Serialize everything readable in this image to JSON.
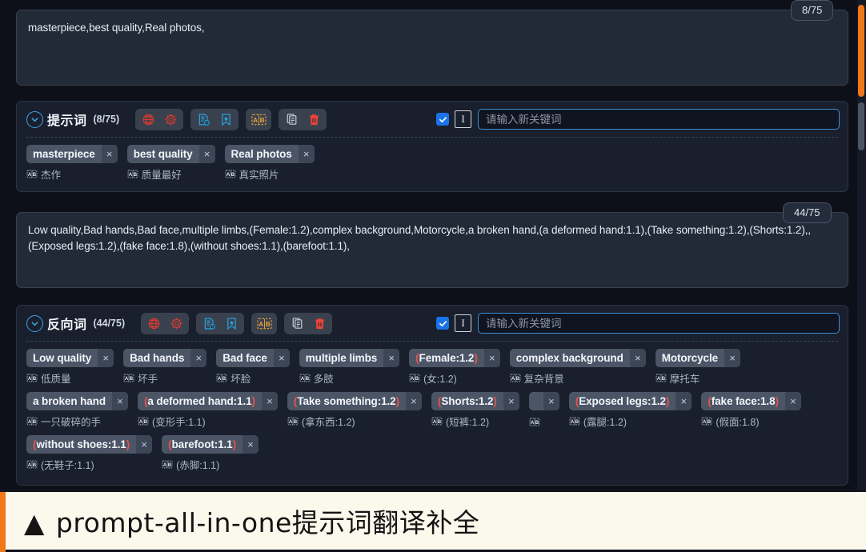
{
  "theme": {
    "bg": "#0d1019",
    "panel": "#191f2c",
    "textarea_bg": "#222a38",
    "accent_blue": "#3aa6e8",
    "accent_orange": "#f07818",
    "chip_bg": "#4b5566",
    "weight_paren": "#e8544a"
  },
  "positive": {
    "textarea_value": "masterpiece,best quality,Real photos,",
    "counter": "8/75",
    "section": {
      "title": "提示词",
      "count": "(8/75)",
      "collapse_icon": "chevron-down-circle-icon",
      "icon_groups": [
        {
          "name": "network-group",
          "icons": [
            {
              "name": "globe-icon",
              "color": "#d93a2f"
            },
            {
              "name": "gear-icon",
              "color": "#d93a2f"
            }
          ]
        },
        {
          "name": "history-group",
          "icons": [
            {
              "name": "document-history-icon",
              "color": "#29a3e0"
            },
            {
              "name": "bookmark-star-icon",
              "color": "#29a3e0"
            }
          ]
        },
        {
          "name": "translate-group",
          "icons": [
            {
              "name": "ab-translate-icon",
              "color": "#e8a33d"
            }
          ]
        },
        {
          "name": "edit-group",
          "icons": [
            {
              "name": "copy-icon",
              "color": "#c8d0dc"
            },
            {
              "name": "trash-icon",
              "color": "#e8443a"
            }
          ]
        }
      ],
      "checkbox_checked": true,
      "cursor_icon": "text-cursor-icon",
      "input_placeholder": "请输入新关键词",
      "input_value": ""
    },
    "tags": [
      {
        "label": "masterpiece",
        "translation": "杰作"
      },
      {
        "label": "best quality",
        "translation": "质量最好"
      },
      {
        "label": "Real photos",
        "translation": "真实照片"
      }
    ]
  },
  "negative": {
    "textarea_value": "Low quality,Bad hands,Bad face,multiple limbs,(Female:1.2),complex background,Motorcycle,a broken hand,(a deformed hand:1.1),(Take something:1.2),(Shorts:1.2),,(Exposed legs:1.2),(fake face:1.8),(without shoes:1.1),(barefoot:1.1),",
    "counter": "44/75",
    "section": {
      "title": "反向词",
      "count": "(44/75)",
      "collapse_icon": "chevron-down-circle-icon",
      "icon_groups": [
        {
          "name": "network-group",
          "icons": [
            {
              "name": "globe-icon",
              "color": "#d93a2f"
            },
            {
              "name": "gear-icon",
              "color": "#d93a2f"
            }
          ]
        },
        {
          "name": "history-group",
          "icons": [
            {
              "name": "document-history-icon",
              "color": "#29a3e0"
            },
            {
              "name": "bookmark-star-icon",
              "color": "#29a3e0"
            }
          ]
        },
        {
          "name": "translate-group",
          "icons": [
            {
              "name": "ab-translate-icon",
              "color": "#e8a33d"
            }
          ]
        },
        {
          "name": "edit-group",
          "icons": [
            {
              "name": "copy-icon",
              "color": "#c8d0dc"
            },
            {
              "name": "trash-icon",
              "color": "#e8443a"
            }
          ]
        }
      ],
      "checkbox_checked": true,
      "cursor_icon": "text-cursor-icon",
      "input_placeholder": "请输入新关键词",
      "input_value": ""
    },
    "tags": [
      {
        "label": "Low quality",
        "translation": "低质量",
        "weighted": false
      },
      {
        "label": "Bad hands",
        "translation": "坏手",
        "weighted": false
      },
      {
        "label": "Bad face",
        "translation": "坏脸",
        "weighted": false
      },
      {
        "label": "multiple limbs",
        "translation": "多肢",
        "weighted": false
      },
      {
        "label": "(Female:1.2)",
        "translation": "(女:1.2)",
        "weighted": true
      },
      {
        "label": "complex background",
        "translation": "复杂背景",
        "weighted": false
      },
      {
        "label": "Motorcycle",
        "translation": "摩托车",
        "weighted": false
      },
      {
        "label": "a broken hand",
        "translation": "一只破碎的手",
        "weighted": false
      },
      {
        "label": "(a deformed hand:1.1)",
        "translation": "(变形手:1.1)",
        "weighted": true
      },
      {
        "label": "(Take something:1.2)",
        "translation": "(拿东西:1.2)",
        "weighted": true
      },
      {
        "label": "(Shorts:1.2)",
        "translation": "(短裤:1.2)",
        "weighted": true
      },
      {
        "label": "",
        "translation": "",
        "weighted": false
      },
      {
        "label": "(Exposed legs:1.2)",
        "translation": "(露腿:1.2)",
        "weighted": true
      },
      {
        "label": "(fake face:1.8)",
        "translation": "(假面:1.8)",
        "weighted": true
      },
      {
        "label": "(without shoes:1.1)",
        "translation": "(无鞋子:1.1)",
        "weighted": true
      },
      {
        "label": "(barefoot:1.1)",
        "translation": "(赤脚:1.1)",
        "weighted": true
      }
    ]
  },
  "scrollbar": {
    "orange_thumb_color": "#f07818",
    "gray_thumb_color": "#4b5566"
  },
  "caption": {
    "marker": "▲",
    "text": "prompt-all-in-one提示词翻译补全"
  }
}
